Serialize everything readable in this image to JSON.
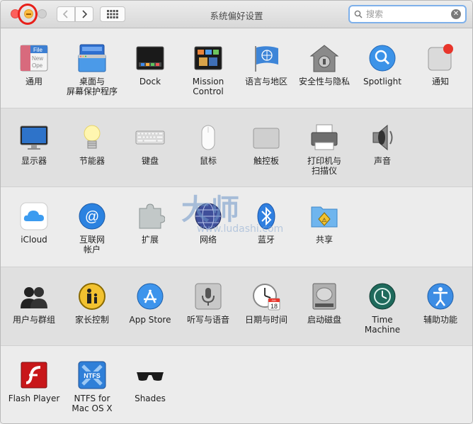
{
  "window": {
    "title": "系统偏好设置"
  },
  "search": {
    "placeholder": "搜索"
  },
  "watermark": {
    "main": "大师",
    "site": "www.ludashi.com"
  },
  "sections": [
    {
      "items": [
        {
          "label": "通用",
          "icon": "general-icon"
        },
        {
          "label": "桌面与\n屏幕保护程序",
          "icon": "desktop-screensaver-icon"
        },
        {
          "label": "Dock",
          "icon": "dock-icon"
        },
        {
          "label": "Mission\nControl",
          "icon": "mission-control-icon"
        },
        {
          "label": "语言与地区",
          "icon": "language-region-icon"
        },
        {
          "label": "安全性与隐私",
          "icon": "security-privacy-icon"
        },
        {
          "label": "Spotlight",
          "icon": "spotlight-icon"
        },
        {
          "label": "通知",
          "icon": "notifications-icon"
        }
      ]
    },
    {
      "items": [
        {
          "label": "显示器",
          "icon": "displays-icon"
        },
        {
          "label": "节能器",
          "icon": "energy-saver-icon"
        },
        {
          "label": "键盘",
          "icon": "keyboard-icon"
        },
        {
          "label": "鼠标",
          "icon": "mouse-icon"
        },
        {
          "label": "触控板",
          "icon": "trackpad-icon"
        },
        {
          "label": "打印机与\n扫描仪",
          "icon": "printers-scanners-icon"
        },
        {
          "label": "声音",
          "icon": "sound-icon"
        }
      ]
    },
    {
      "items": [
        {
          "label": "iCloud",
          "icon": "icloud-icon"
        },
        {
          "label": "互联网\n帐户",
          "icon": "internet-accounts-icon"
        },
        {
          "label": "扩展",
          "icon": "extensions-icon"
        },
        {
          "label": "网络",
          "icon": "network-icon"
        },
        {
          "label": "蓝牙",
          "icon": "bluetooth-icon"
        },
        {
          "label": "共享",
          "icon": "sharing-icon"
        }
      ]
    },
    {
      "items": [
        {
          "label": "用户与群组",
          "icon": "users-groups-icon"
        },
        {
          "label": "家长控制",
          "icon": "parental-controls-icon"
        },
        {
          "label": "App Store",
          "icon": "app-store-icon"
        },
        {
          "label": "听写与语音",
          "icon": "dictation-speech-icon"
        },
        {
          "label": "日期与时间",
          "icon": "date-time-icon"
        },
        {
          "label": "启动磁盘",
          "icon": "startup-disk-icon"
        },
        {
          "label": "Time Machine",
          "icon": "time-machine-icon"
        },
        {
          "label": "辅助功能",
          "icon": "accessibility-icon"
        }
      ]
    },
    {
      "items": [
        {
          "label": "Flash Player",
          "icon": "flash-player-icon"
        },
        {
          "label": "NTFS for\nMac OS X",
          "icon": "ntfs-icon"
        },
        {
          "label": "Shades",
          "icon": "shades-icon"
        }
      ]
    }
  ],
  "icon_text": {
    "general_file": "File",
    "general_new": "New",
    "general_open": "Ope",
    "ntfs": "NTFS",
    "calendar_day": "18",
    "calendar_month": "JUL"
  }
}
